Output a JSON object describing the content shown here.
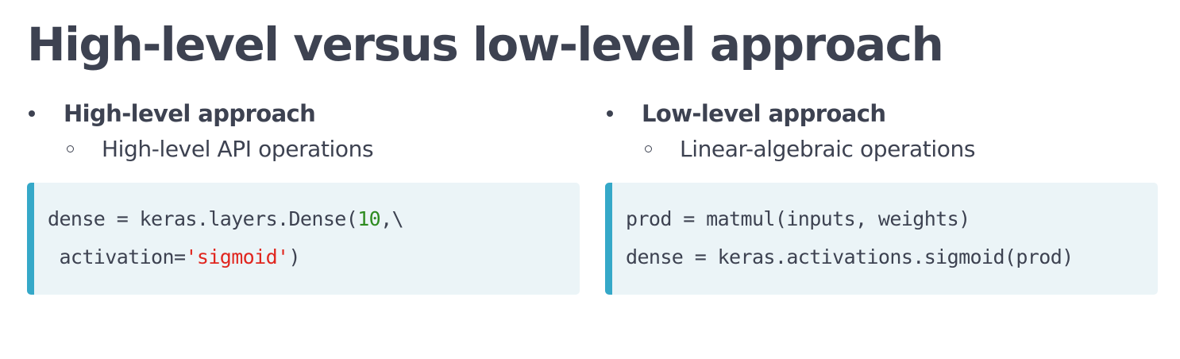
{
  "slide": {
    "title": "High-level versus low-level approach"
  },
  "columns": [
    {
      "heading": "High-level approach",
      "subitem": "High-level API operations",
      "code": {
        "line1_pre": "dense = keras.layers.Dense(",
        "line1_num": "10",
        "line1_post": ",\\",
        "line2_pre": " activation=",
        "line2_str": "'sigmoid'",
        "line2_post": ")"
      }
    },
    {
      "heading": "Low-level approach",
      "subitem": "Linear-algebraic operations",
      "code": {
        "line1": "prod = matmul(inputs, weights)",
        "line2": "dense = keras.activations.sigmoid(prod)"
      }
    }
  ],
  "colors": {
    "text": "#3d4251",
    "code_background": "#ebf4f7",
    "code_accent_bar": "#35a8c8",
    "number_token": "#2e8b20",
    "string_token": "#e0261f"
  }
}
